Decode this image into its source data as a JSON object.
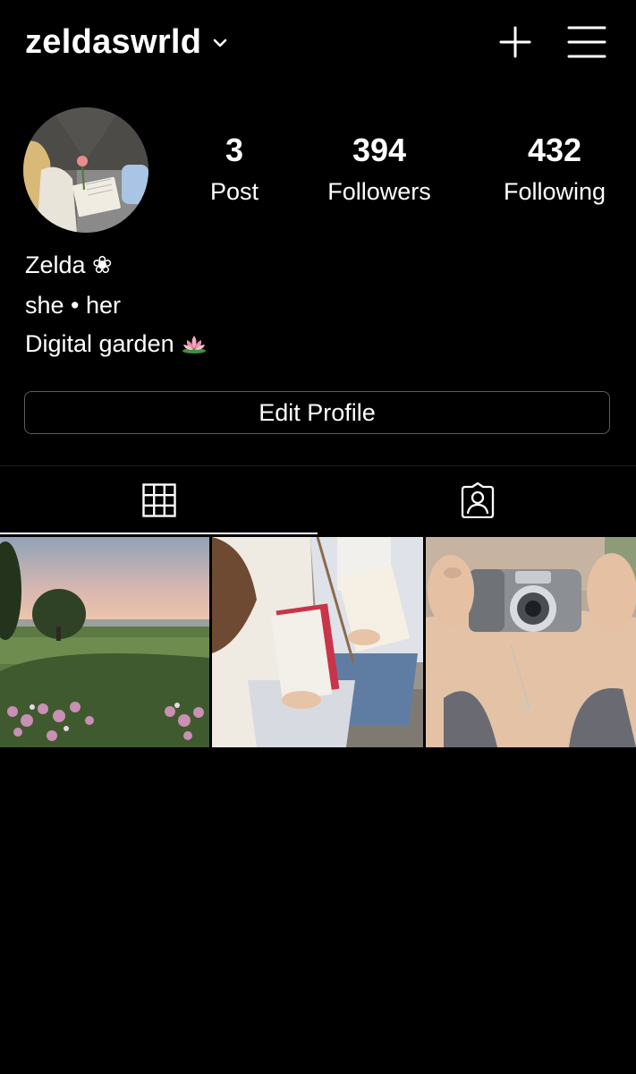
{
  "header": {
    "username": "zeldaswrld",
    "icons": {
      "dropdown": "chevron-down-icon",
      "add": "plus-icon",
      "menu": "hamburger-menu-icon"
    }
  },
  "profile": {
    "avatar_icon": "profile-photo",
    "stats": {
      "posts": {
        "value": "3",
        "label": "Post"
      },
      "followers": {
        "value": "394",
        "label": "Followers"
      },
      "following": {
        "value": "432",
        "label": "Following"
      }
    }
  },
  "bio": {
    "name": "Zelda ❀",
    "pronouns": "she • her",
    "description": "Digital garden"
  },
  "edit_profile_label": "Edit Profile",
  "tabs": [
    {
      "icon": "grid-icon",
      "active": true
    },
    {
      "icon": "tagged-person-icon",
      "active": false
    }
  ],
  "posts": [
    {
      "subject": "countryside landscape with tree and flowers"
    },
    {
      "subject": "two people holding notebooks"
    },
    {
      "subject": "person holding camera"
    }
  ],
  "colors": {
    "background": "#000000",
    "text": "#ffffff",
    "button_border": "#5c5c5c"
  }
}
